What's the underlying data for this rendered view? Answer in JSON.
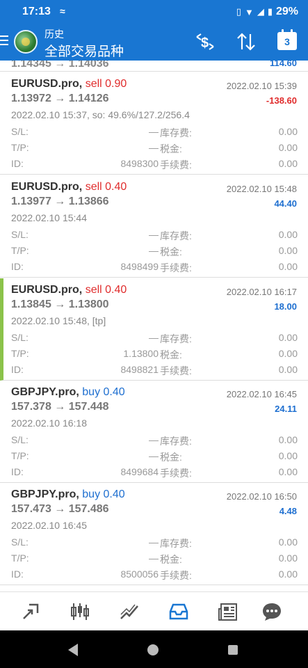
{
  "status": {
    "time": "17:13",
    "battery": "29%"
  },
  "header": {
    "subtitle": "历史",
    "title": "全部交易品种",
    "calendar_day": "3"
  },
  "partial_row": {
    "prices": "1.14345 → 1.14036",
    "profit": "114.60"
  },
  "labels": {
    "sl": "S/L:",
    "tp": "T/P:",
    "id": "ID:",
    "swap": "库存费:",
    "tax": "税金:",
    "fee": "手续费:"
  },
  "trades": [
    {
      "symbol": "EURUSD.pro,",
      "direction": "sell 0.90",
      "prices": "1.13972 → 1.14126",
      "close_time": "2022.02.10 15:39",
      "profit": "-138.60",
      "open_info": "2022.02.10 15:37, so: 49.6%/127.2/256.4",
      "sl": "—",
      "tp": "—",
      "id": "8498300",
      "swap": "0.00",
      "tax": "0.00",
      "fee": "0.00"
    },
    {
      "symbol": "EURUSD.pro,",
      "direction": "sell 0.40",
      "prices": "1.13977 → 1.13866",
      "close_time": "2022.02.10 15:48",
      "profit": "44.40",
      "open_info": "2022.02.10 15:44",
      "sl": "—",
      "tp": "—",
      "id": "8498499",
      "swap": "0.00",
      "tax": "0.00",
      "fee": "0.00"
    },
    {
      "symbol": "EURUSD.pro,",
      "direction": "sell 0.40",
      "prices": "1.13845 → 1.13800",
      "close_time": "2022.02.10 16:17",
      "profit": "18.00",
      "open_info": "2022.02.10 15:48, [tp]",
      "sl": "—",
      "tp": "1.13800",
      "id": "8498821",
      "swap": "0.00",
      "tax": "0.00",
      "fee": "0.00"
    },
    {
      "symbol": "GBPJPY.pro,",
      "direction": "buy 0.40",
      "prices": "157.378 → 157.448",
      "close_time": "2022.02.10 16:45",
      "profit": "24.11",
      "open_info": "2022.02.10 16:18",
      "sl": "—",
      "tp": "—",
      "id": "8499684",
      "swap": "0.00",
      "tax": "0.00",
      "fee": "0.00"
    },
    {
      "symbol": "GBPJPY.pro,",
      "direction": "buy 0.40",
      "prices": "157.473 → 157.486",
      "close_time": "2022.02.10 16:50",
      "profit": "4.48",
      "open_info": "2022.02.10 16:45",
      "sl": "—",
      "tp": "—",
      "id": "8500056",
      "swap": "0.00",
      "tax": "0.00",
      "fee": "0.00"
    }
  ],
  "bottom_nav": [
    "quotes-icon",
    "chart-icon",
    "trade-icon",
    "history-icon",
    "news-icon",
    "chat-icon"
  ],
  "colors": {
    "brand": "#1976d2",
    "sell": "#e02c2c",
    "buy": "#1e6fd0",
    "highlight": "#8bc34a"
  }
}
